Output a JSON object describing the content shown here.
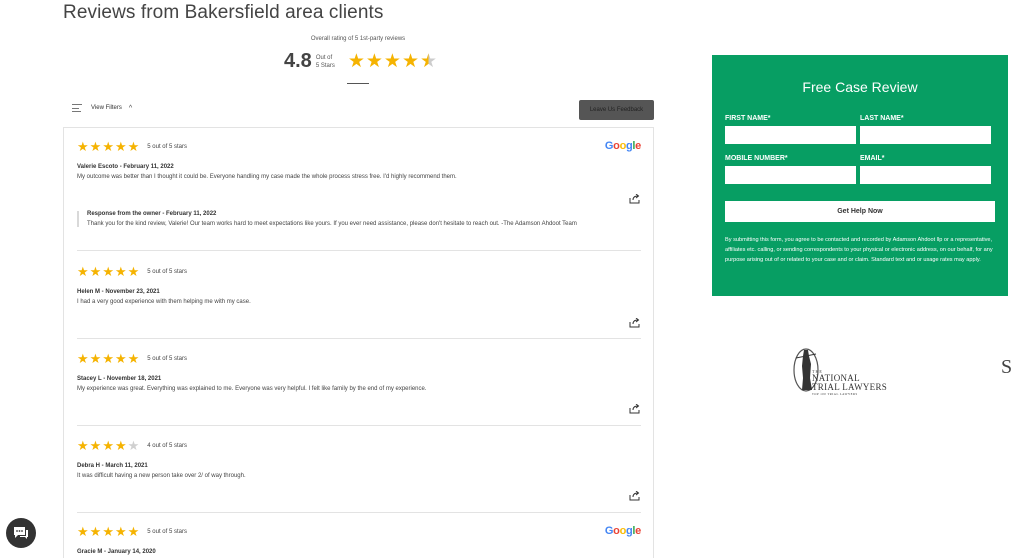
{
  "page": {
    "title": "Reviews from Bakersfield area clients"
  },
  "summary": {
    "caption": "Overall rating of 5 1st-party reviews",
    "score": "4.8",
    "out_of_line1": "Out of",
    "out_of_line2": "5 Stars",
    "rating": 4.8,
    "max_rating": 5
  },
  "filters": {
    "label": "View Filters",
    "leave_feedback": "Leave Us Feedback"
  },
  "reviews": [
    {
      "stars": 5,
      "stars_label": "5 out of 5 stars",
      "source": "Google",
      "author": "Valerie Escoto - February 11, 2022",
      "text": "My outcome was better than I thought it could be. Everyone handling my case made the whole process stress free. I'd highly recommend them.",
      "response": {
        "title": "Response from the owner - February 11, 2022",
        "text": "Thank you for the kind review, Valerie! Our team works hard to meet expectations like yours. If you ever need assistance, please don't hesitate to reach out. -The Adamson Ahdoot Team"
      }
    },
    {
      "stars": 5,
      "stars_label": "5 out of 5 stars",
      "author": "Helen M - November 23, 2021",
      "text": "I had a very good experience with them helping me with my case."
    },
    {
      "stars": 5,
      "stars_label": "5 out of 5 stars",
      "author": "Stacey L - November 18, 2021",
      "text": "My experience was great. Everything was explained to me. Everyone was very helpful. I felt like family by the end of my experience."
    },
    {
      "stars": 4,
      "stars_label": "4 out of 5 stars",
      "author": "Debra H - March 11, 2021",
      "text": "It was difficult having a new person take over 2/ of way through."
    },
    {
      "stars": 5,
      "stars_label": "5 out of 5 stars",
      "source": "Google",
      "author": "Gracie M - January 14, 2020",
      "text": ""
    }
  ],
  "form": {
    "title": "Free Case Review",
    "first_name": "FIRST NAME*",
    "last_name": "LAST NAME*",
    "mobile": "MOBILE NUMBER*",
    "email": "EMAIL*",
    "submit": "Get Help Now",
    "disclaimer": "By submitting this form, you agree to be contacted and recorded by Adamson Ahdoot llp or a representative, affiliates etc. calling, or sending correspondents to your physical or electronic address, on our behalf, for any purpose arising out of or related to your case and or claim. Standard text and or usage rates may apply."
  },
  "badge": {
    "line1": "THE",
    "line2": "NATIONAL",
    "line3": "TRIAL LAWYERS",
    "line4": "TOP 100 TRIAL LAWYERS"
  },
  "edge_glyph": "S",
  "colors": {
    "accent": "#079e63",
    "star": "#f5b301",
    "star_off": "#d0d0d0"
  },
  "icons": {
    "share": "share-icon",
    "chat": "chat-icon",
    "filter": "filter-icon",
    "chevron": "chevron-up-icon"
  }
}
